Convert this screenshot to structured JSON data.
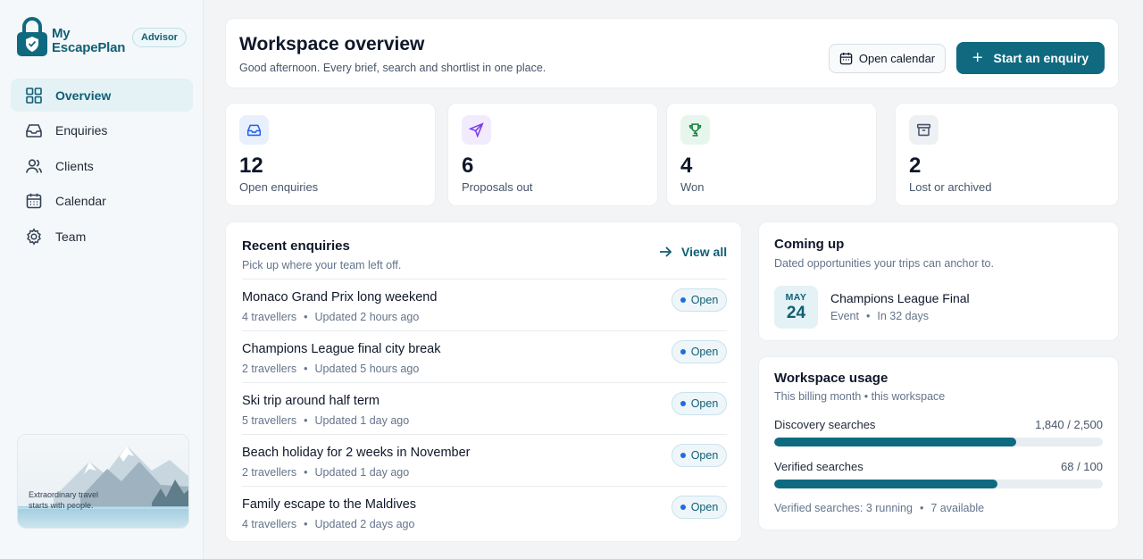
{
  "brand": {
    "name_line1": "My",
    "name_line2": "EscapePlan",
    "role_badge": "Advisor"
  },
  "nav": {
    "items": [
      {
        "label": "Overview",
        "icon": "grid-icon",
        "active": true
      },
      {
        "label": "Enquiries",
        "icon": "inbox-icon"
      },
      {
        "label": "Clients",
        "icon": "users-icon"
      },
      {
        "label": "Calendar",
        "icon": "calendar-icon"
      },
      {
        "label": "Team",
        "icon": "gear-icon"
      }
    ]
  },
  "promo": {
    "text": "Extraordinary travel starts with people."
  },
  "header": {
    "title": "Workspace overview",
    "subtitle": "Good afternoon. Every brief, search and shortlist in one place.",
    "open_calendar_label": "Open calendar",
    "start_enquiry_label": "Start an enquiry"
  },
  "stats": [
    {
      "value": "12",
      "label": "Open enquiries",
      "icon": "inbox-icon",
      "color": "#2563eb",
      "bg": "#e8f0fd"
    },
    {
      "value": "6",
      "label": "Proposals out",
      "icon": "send-icon",
      "color": "#7c3aed",
      "bg": "#f1ebfd"
    },
    {
      "value": "4",
      "label": "Won",
      "icon": "trophy-icon",
      "color": "#15803d",
      "bg": "#e7f6ec"
    },
    {
      "value": "2",
      "label": "Lost or archived",
      "icon": "archive-icon",
      "color": "#475569",
      "bg": "#eef1f4"
    }
  ],
  "recent": {
    "title": "Recent enquiries",
    "subtitle": "Pick up where your team left off.",
    "view_all_label": "View all",
    "items": [
      {
        "title": "Monaco Grand Prix long weekend",
        "travellers": "4 travellers",
        "updated": "Updated 2 hours ago",
        "status": "Open"
      },
      {
        "title": "Champions League final city break",
        "travellers": "2 travellers",
        "updated": "Updated 5 hours ago",
        "status": "Open"
      },
      {
        "title": "Ski trip around half term",
        "travellers": "5 travellers",
        "updated": "Updated 1 day ago",
        "status": "Open"
      },
      {
        "title": "Beach holiday for 2 weeks in November",
        "travellers": "2 travellers",
        "updated": "Updated 1 day ago",
        "status": "Open"
      },
      {
        "title": "Family escape to the Maldives",
        "travellers": "4 travellers",
        "updated": "Updated 2 days ago",
        "status": "Open"
      }
    ]
  },
  "coming_up": {
    "title": "Coming up",
    "subtitle": "Dated opportunities your trips can anchor to.",
    "event": {
      "month": "MAY",
      "day": "24",
      "title": "Champions League Final",
      "type": "Event",
      "when": "In 32 days"
    }
  },
  "usage": {
    "title": "Workspace usage",
    "subtitle": "This billing month • this workspace",
    "meters": [
      {
        "label": "Discovery searches",
        "value_text": "1,840 / 2,500",
        "used": 1840,
        "total": 2500
      },
      {
        "label": "Verified searches",
        "value_text": "68 / 100",
        "used": 68,
        "total": 100
      }
    ],
    "footer_running": "Verified searches: 3 running",
    "footer_available": "7 available"
  },
  "colors": {
    "brand": "#0f6a80",
    "brand_dark": "#0f5f74",
    "active_bg": "#e4f1f5",
    "status_dot": "#1d6fd8"
  }
}
